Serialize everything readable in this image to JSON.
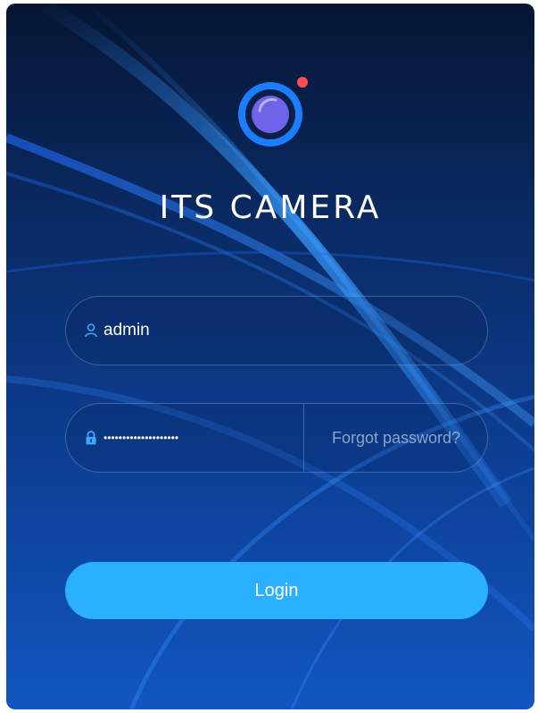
{
  "app": {
    "title": "ITS CAMERA"
  },
  "login": {
    "username_value": "admin",
    "password_value": "••••••••••••••••••••",
    "forgot_label": "Forgot password?",
    "login_label": "Login"
  },
  "icons": {
    "logo": "camera-lens-icon",
    "username": "user-icon",
    "password": "lock-icon"
  },
  "colors": {
    "accent": "#2bb0ff",
    "background_top": "#061633",
    "background_bottom": "#1156c0",
    "status_dot": "#ff4d4f"
  }
}
